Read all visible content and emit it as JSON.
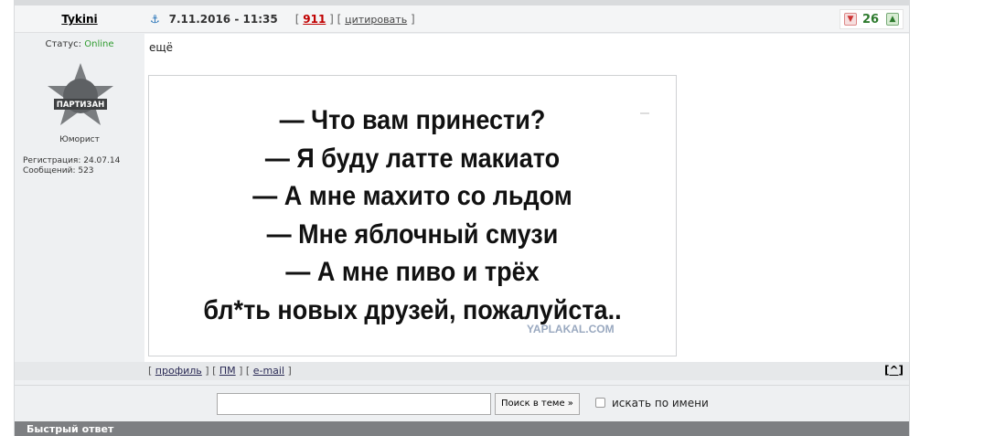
{
  "post": {
    "author": "Tykini",
    "date": "7.11.2016 - 11:35",
    "number": "911",
    "quote_label": "цитировать",
    "rating": "26",
    "text": "ещё"
  },
  "user": {
    "status_label": "Статус:",
    "status_value": "Online",
    "avatar_text": "ПАРТИЗАН",
    "rank": "Юморист",
    "registration": "Регистрация: 24.07.14",
    "messages": "Сообщений: 523"
  },
  "meme": {
    "lines": [
      "— Что вам принести?",
      "— Я буду латте макиато",
      "— А мне махито со льдом",
      "— Мне яблочный смузи",
      "— А мне пиво и трёх",
      "бл*ть новых друзей, пожалуйста.."
    ],
    "watermark": "YAPLAKAL.COM"
  },
  "footer": {
    "profile": "профиль",
    "pm": "ПМ",
    "email": "e-mail",
    "top_label": "^"
  },
  "search": {
    "input_value": "",
    "button_label": "Поиск в теме »",
    "checkbox_label": "искать по имени"
  },
  "quick_reply": {
    "title": "Быстрый ответ"
  },
  "colors": {
    "online": "#2e9b2e",
    "post_number": "#c00000",
    "rating": "#2d7a2d"
  }
}
